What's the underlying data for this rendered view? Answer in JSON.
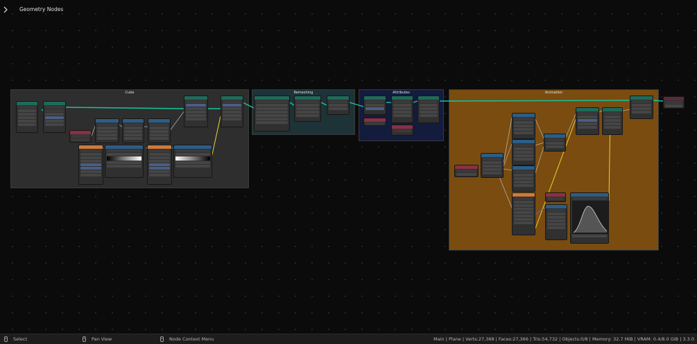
{
  "header": {
    "title": "Geometry Nodes",
    "toggle_icon": "chevron-right-icon"
  },
  "frames": {
    "cube": "Cube",
    "remeshing": "Remeshing",
    "attributes": "Attributes",
    "animation": "Animation"
  },
  "colors": {
    "frame_cube": "#2e2e2e",
    "frame_remeshing": "#1d3337",
    "frame_attributes": "#131c3d",
    "frame_animation": "#7a4c10",
    "geometry_wire": "#16c6a0",
    "float_wire": "#b8b8b8",
    "vector_wire": "#6363c7",
    "field_wire": "#e0d838",
    "header_geometry": "#1f6b5a",
    "header_input": "#8a3045",
    "header_converter": "#2b5d88",
    "header_texture": "#cf7a3a"
  },
  "statusbar": {
    "select": "Select",
    "pan_view": "Pan View",
    "context_menu": "Node Context Menu",
    "stats": "Main | Plane | Verts:27,368 | Faces:27,366 | Tris:54,732 | Objects:0/8 | Memory: 32.7 MiB | VRAM: 0.4/8.0 GiB | 3.3.0"
  }
}
